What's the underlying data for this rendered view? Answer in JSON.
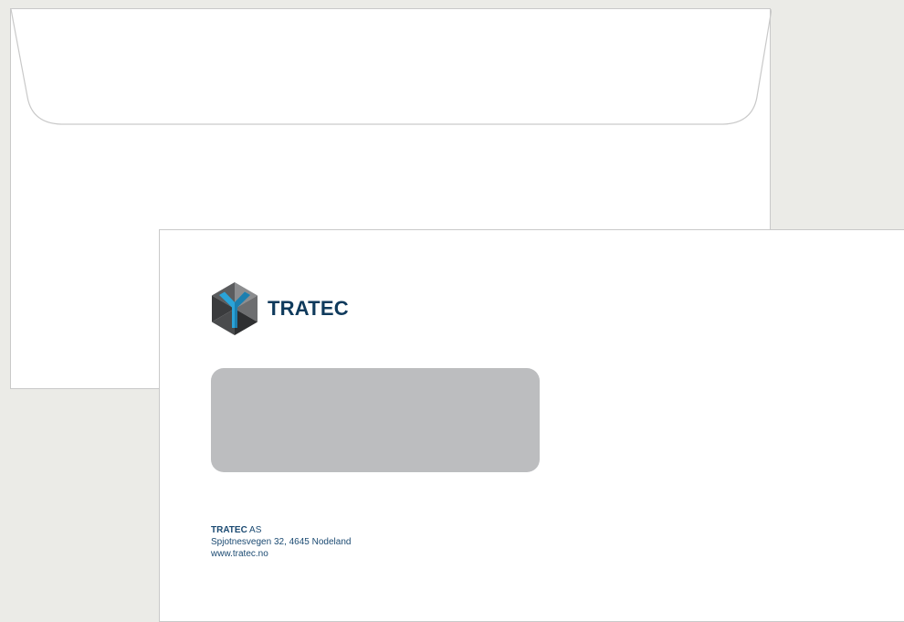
{
  "envelope_back": {
    "flap": "seal-flap"
  },
  "envelope_front": {
    "logo": {
      "icon": "tratec-hexagon-logo-icon",
      "text": "TRATEC"
    },
    "address_window": "address-window",
    "sender": {
      "brand": "TRATEC",
      "company_suffix": "AS",
      "address": "Spjotnesvegen 32, 4645 Nodeland",
      "website": "www.tratec.no"
    }
  },
  "colors": {
    "background": "#ebebe7",
    "brand_navy": "#0f3a5c",
    "brand_blue": "#2aa3d8",
    "window_gray": "#bcbdbf",
    "sender_text": "#1b4a72"
  }
}
